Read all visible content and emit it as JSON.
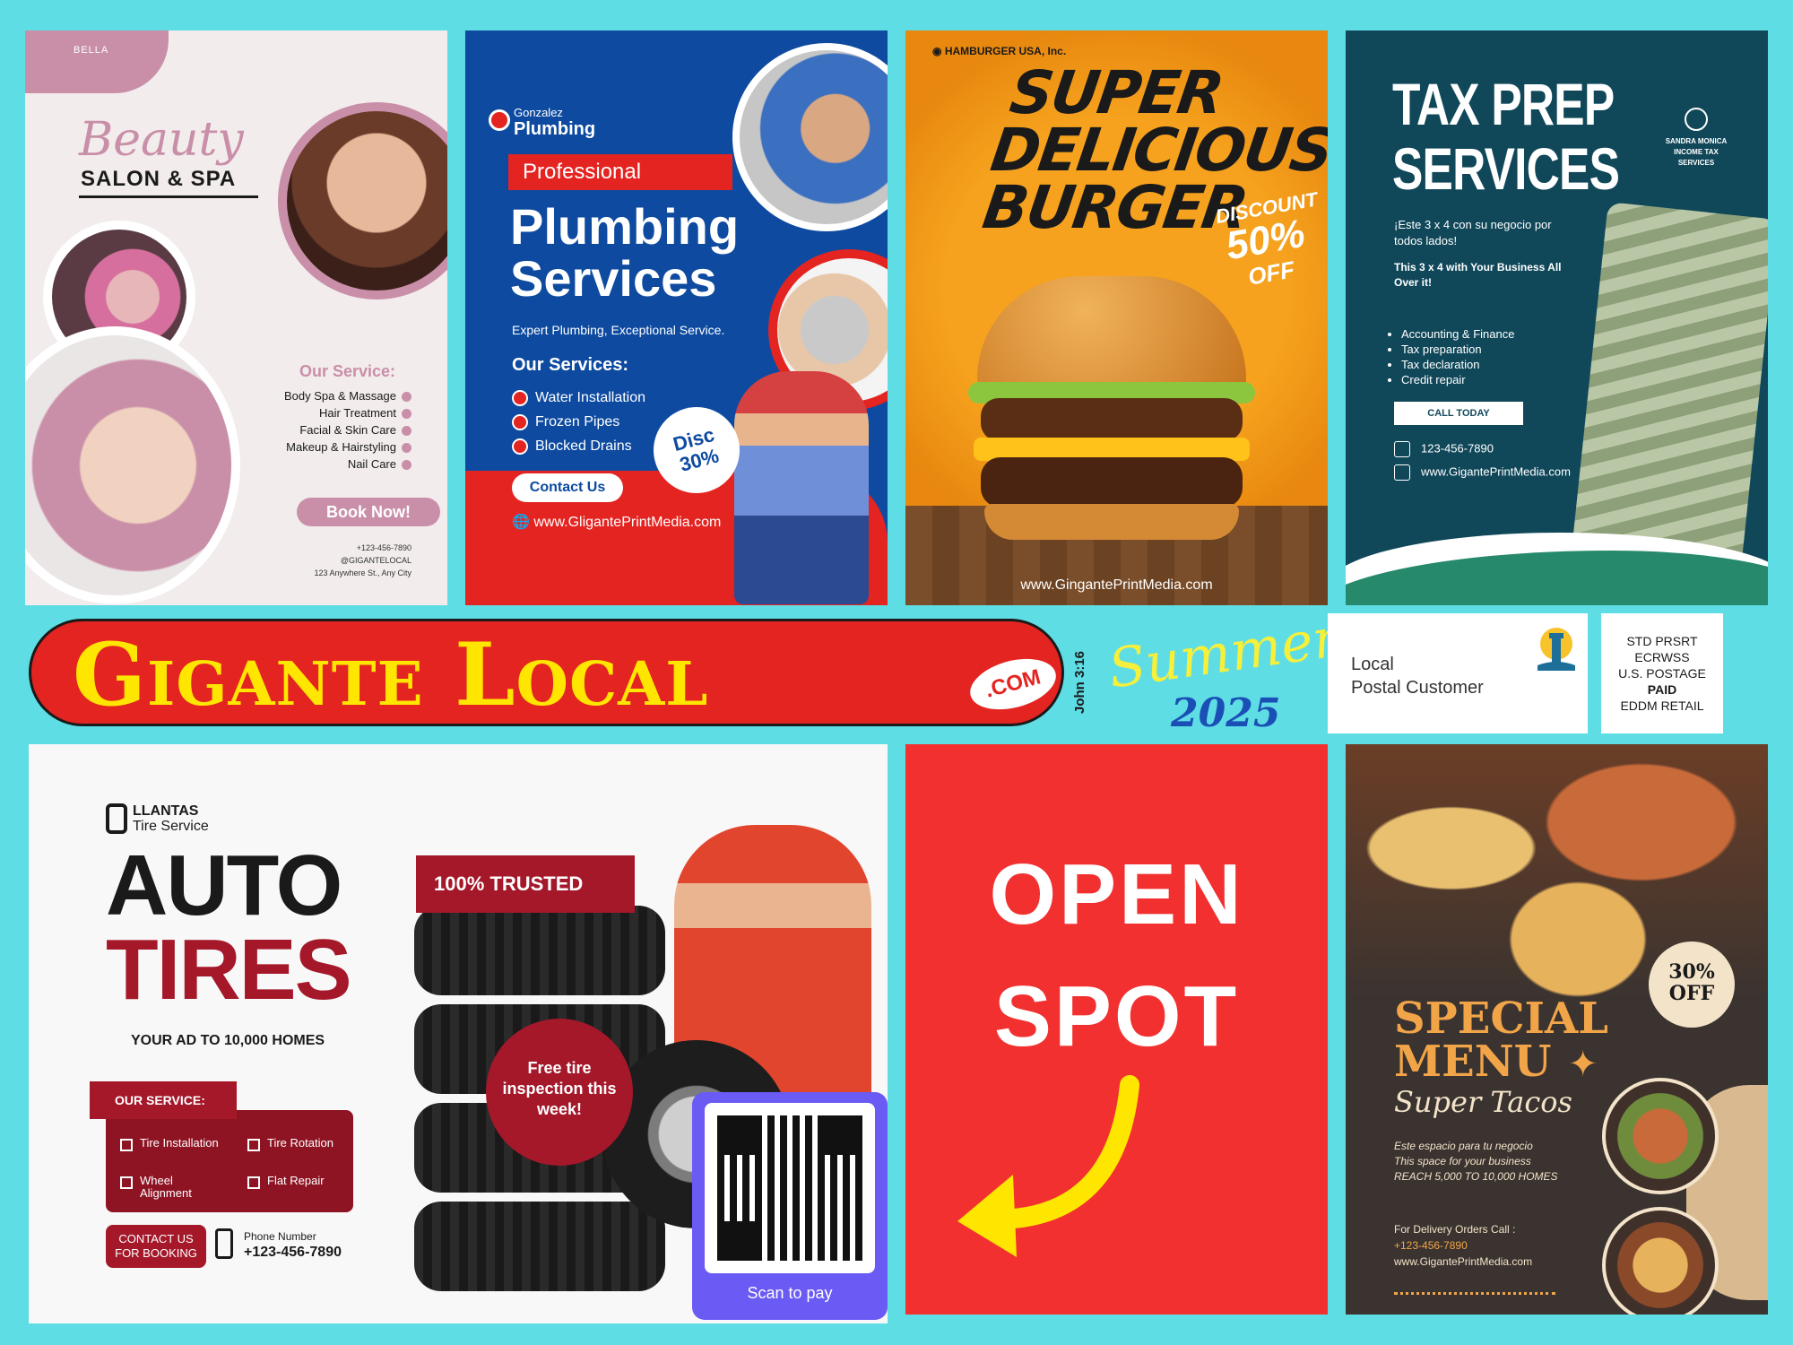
{
  "beauty": {
    "brand": "BELLA",
    "script_title": "Beauty",
    "title": "SALON & SPA",
    "services_title": "Our Service:",
    "services": [
      "Body Spa & Massage",
      "Hair Treatment",
      "Facial & Skin Care",
      "Makeup & Hairstyling",
      "Nail Care"
    ],
    "cta": "Book Now!",
    "phone": "+123-456-7890",
    "handle": "@GIGANTELOCAL",
    "address": "123 Anywhere St., Any City"
  },
  "plumbing": {
    "brand_top": "Gonzalez",
    "brand_bottom": "Plumbing",
    "tagline": "Professional",
    "title_1": "Plumbing",
    "title_2": "Services",
    "subtitle": "Expert Plumbing, Exceptional Service.",
    "services_title": "Our Services:",
    "services": [
      "Water Installation",
      "Frozen Pipes",
      "Blocked Drains"
    ],
    "discount_1": "Disc",
    "discount_2": "30%",
    "cta": "Contact Us",
    "website": "www.GligantePrintMedia.com"
  },
  "burger": {
    "company": "HAMBURGER USA, Inc.",
    "title_1": "SUPER",
    "title_2": "DELICIOUS",
    "title_3": "BURGER",
    "discount_label": "DISCOUNT",
    "discount_value": "50%",
    "discount_off": "OFF",
    "website": "www.GingantePrintMedia.com"
  },
  "tax": {
    "title_1": "TAX PREP",
    "title_2": "SERVICES",
    "company": "SANDRA MONICA INCOME TAX SERVICES",
    "text_es": "¡Este 3 x 4 con su negocio por todos lados!",
    "text_en": "This 3 x 4 with Your Business All Over it!",
    "services": [
      "Accounting & Finance",
      "Tax preparation",
      "Tax declaration",
      "Credit repair"
    ],
    "cta": "CALL TODAY",
    "phone": "123-456-7890",
    "website": "www.GigantePrintMedia.com"
  },
  "banner": {
    "name": "Gigante Local",
    "domain": ".COM",
    "verse": "John 3:16",
    "season": "Summer",
    "year": "2025"
  },
  "postal": {
    "line_1": "Local",
    "line_2": "Postal Customer"
  },
  "indicia": {
    "line_1": "STD PRSRT",
    "line_2": "ECRWSS",
    "line_3": "U.S. POSTAGE",
    "line_4": "PAID",
    "line_5": "EDDM RETAIL"
  },
  "tires": {
    "brand_top": "LLANTAS",
    "brand_bottom": "Tire Service",
    "title_1": "AUTO",
    "title_2": "TIRES",
    "reach": "YOUR AD TO 10,000 HOMES",
    "services_title": "OUR SERVICE:",
    "services": [
      "Tire Installation",
      "Tire Rotation",
      "Wheel Alignment",
      "Flat Repair"
    ],
    "cta_1": "CONTACT US",
    "cta_2": "FOR BOOKING",
    "phone_label": "Phone Number",
    "phone": "+123-456-7890",
    "trusted": "100% TRUSTED",
    "promo": "Free tire inspection this week!",
    "qr_label": "Scan to pay"
  },
  "open_spot": {
    "line_1": "OPEN",
    "line_2": "SPOT"
  },
  "tacos": {
    "discount_1": "30%",
    "discount_2": "OFF",
    "title_1": "SPECIAL",
    "title_2": "MENU",
    "subtitle": "Super Tacos",
    "body_1": "Este espacio para tu negocio",
    "body_2": "This space for your business",
    "body_3": "REACH 5,000 TO 10,000 HOMES",
    "delivery": "For Delivery Orders Call :",
    "phone": "+123-456-7890",
    "website": "www.GigantePrintMedia.com"
  },
  "colors": {
    "background": "#5fdde5",
    "banner_red": "#e42421",
    "banner_yellow": "#ffe600",
    "open_spot_red": "#f23030"
  }
}
